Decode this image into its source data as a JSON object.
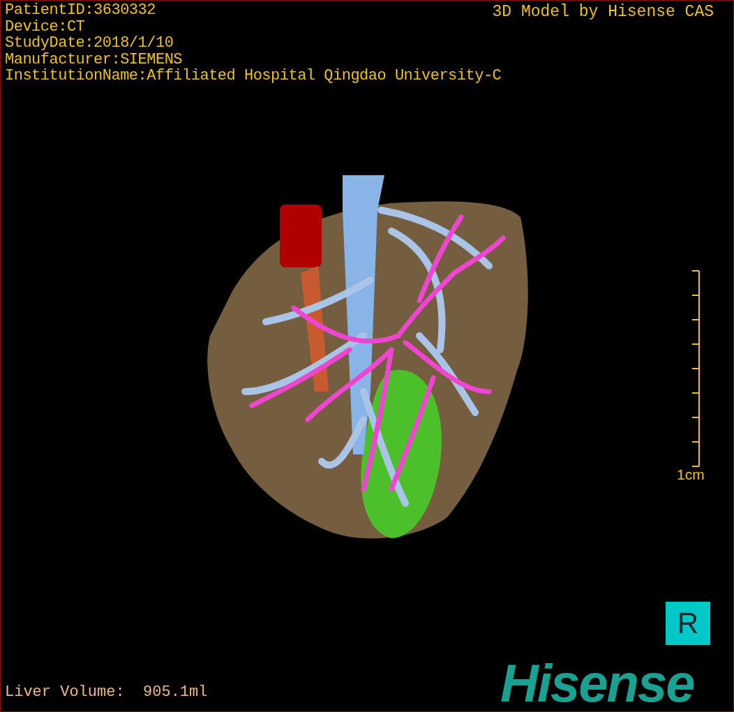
{
  "viewport": {
    "info_lines": [
      "PatientID:3630332",
      "Device:CT",
      "StudyDate:2018/1/10",
      "Manufacturer:SIEMENS",
      "InstitutionName:Affiliated Hospital Qingdao University-C"
    ],
    "credit": "3D Model by Hisense CAS",
    "scale_label": "1cm",
    "orientation_marker": "R",
    "volume": {
      "label": "Liver Volume:",
      "value": "905.1ml"
    },
    "logo": "Hisense"
  }
}
